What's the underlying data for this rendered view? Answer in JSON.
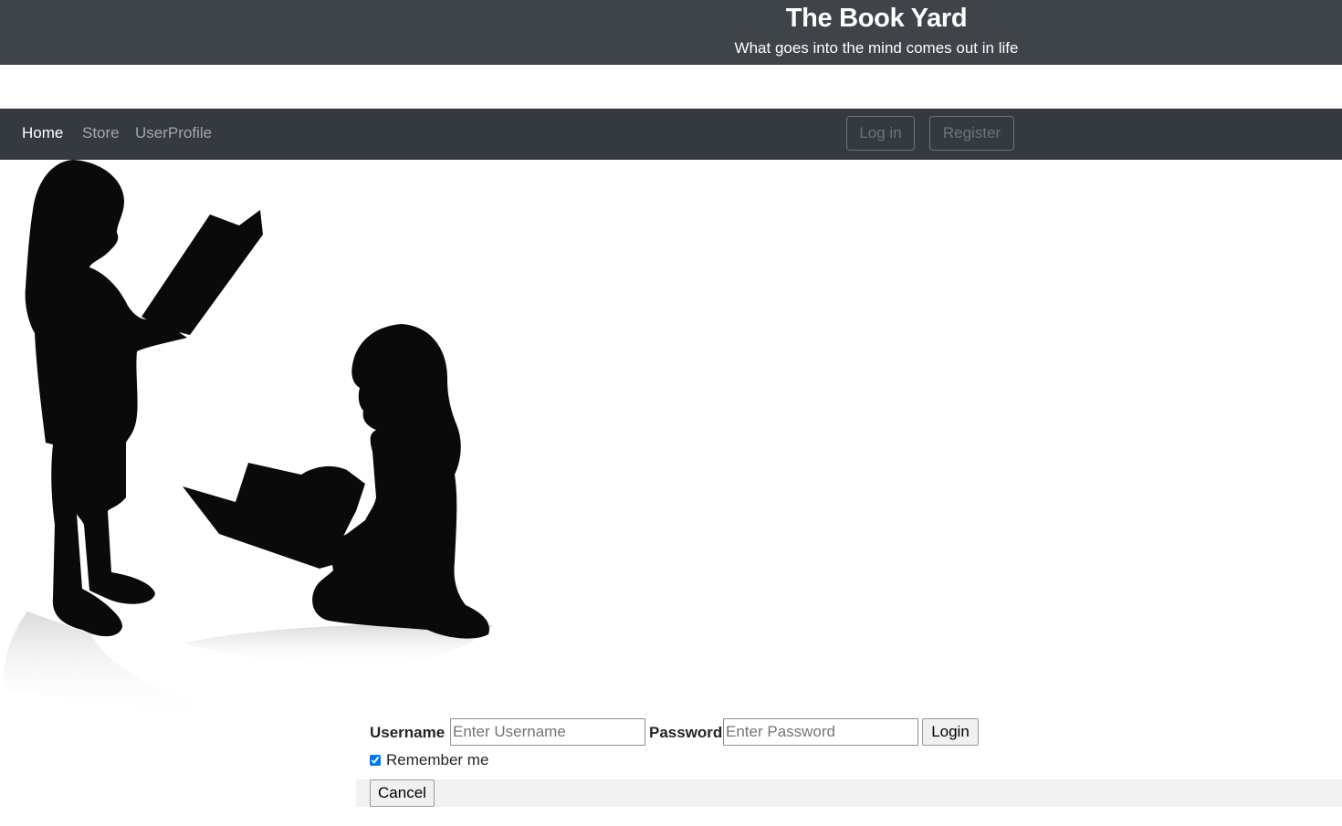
{
  "header": {
    "title": "The Book Yard",
    "tagline": "What goes into the mind comes out in life"
  },
  "nav": {
    "links": [
      {
        "label": "Home",
        "active": true
      },
      {
        "label": "Store",
        "active": false
      },
      {
        "label": "UserProfile",
        "active": false
      }
    ],
    "login_label": "Log in",
    "register_label": "Register"
  },
  "hero": {
    "image_alt": "children-reading-silhouette"
  },
  "login_form": {
    "username_label": "Username",
    "username_placeholder": "Enter Username",
    "password_label": "Password",
    "password_placeholder": "Enter Password",
    "login_button": "Login",
    "remember_label": "Remember me",
    "remember_checked": true,
    "cancel_button": "Cancel"
  },
  "colors": {
    "header_bg": "#3e4448",
    "navbar_bg": "#343a40",
    "cancel_bar_bg": "#f1f1f1"
  }
}
